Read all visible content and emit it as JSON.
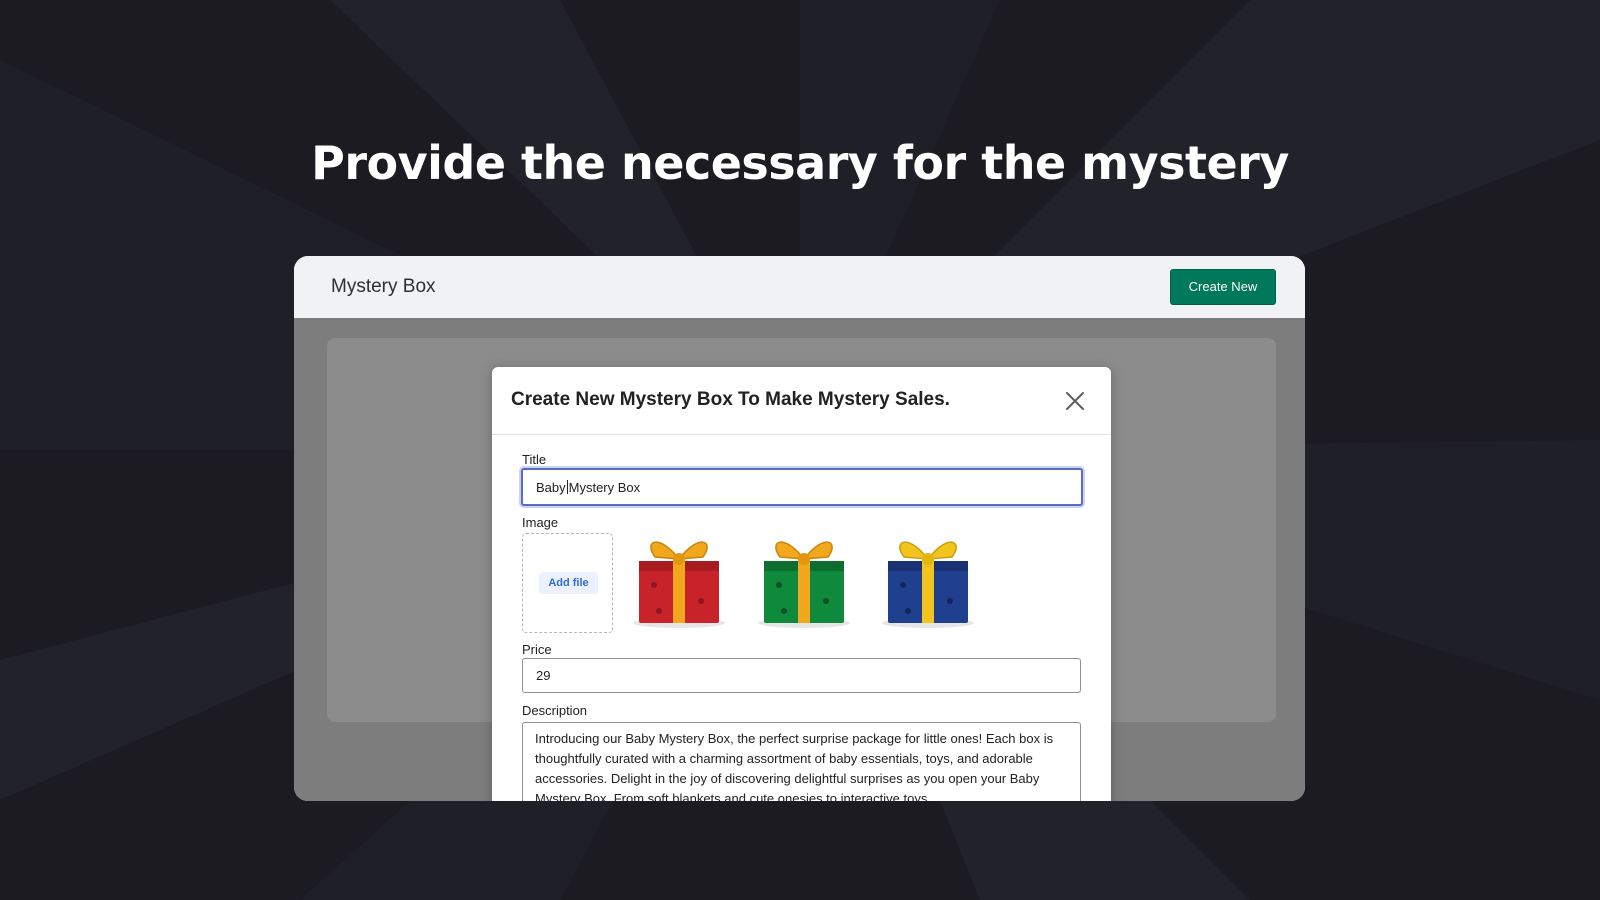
{
  "headline": "Provide the necessary for the mystery",
  "app": {
    "title": "Mystery Box",
    "create_button_label": "Create New"
  },
  "modal": {
    "title": "Create New Mystery Box To Make Mystery Sales.",
    "fields": {
      "title_label": "Title",
      "title_value_before_caret": "Baby",
      "title_value_after_caret": "Mystery Box",
      "image_label": "Image",
      "add_file_label": "Add file",
      "price_label": "Price",
      "price_value": "29",
      "description_label": "Description",
      "description_value": "Introducing our Baby Mystery Box, the perfect surprise package for little ones! Each box is thoughtfully curated with a charming assortment of baby essentials, toys, and adorable accessories. Delight in the joy of discovering delightful surprises as you open your Baby Mystery Box. From soft blankets and cute onesies to interactive toys"
    },
    "images": [
      {
        "icon": "red-gift-box-icon",
        "box_color": "#c8232a",
        "ribbon_color": "#f2a81d"
      },
      {
        "icon": "green-gift-box-icon",
        "box_color": "#0f8a3c",
        "ribbon_color": "#f2a81d"
      },
      {
        "icon": "blue-gift-box-icon",
        "box_color": "#1f3f8f",
        "ribbon_color": "#f2c41d"
      }
    ]
  },
  "colors": {
    "page_background": "#1c1c22",
    "accent_button": "#00785a",
    "focus_ring": "#5c6ac4",
    "link_blue": "#2c6ecb"
  }
}
